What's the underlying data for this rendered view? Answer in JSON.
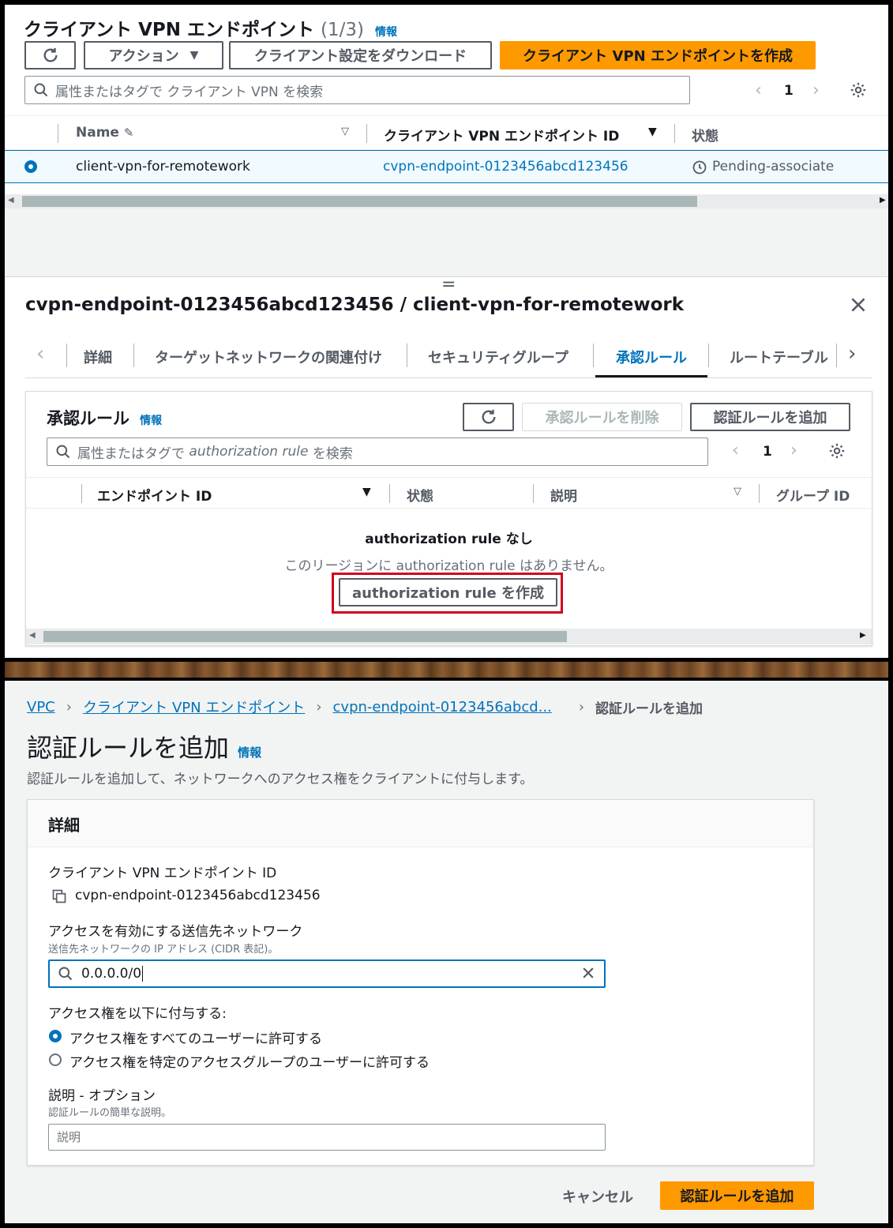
{
  "top": {
    "title": "クライアント VPN エンドポイント",
    "count": "(1/3)",
    "info": "情報",
    "actions_label": "アクション",
    "download_label": "クライアント設定をダウンロード",
    "create_label": "クライアント VPN エンドポイントを作成",
    "search_placeholder": "属性またはタグで クライアント VPN を検索",
    "page": "1",
    "columns": [
      "Name",
      "クライアント VPN エンドポイント ID",
      "状態"
    ],
    "row": {
      "name": "client-vpn-for-remotework",
      "endpoint_id": "cvpn-endpoint-0123456abcd123456",
      "status": "Pending-associate"
    }
  },
  "detail": {
    "drag_handle": "=",
    "title": "cvpn-endpoint-0123456abcd123456 / client-vpn-for-remotework",
    "tabs": [
      "詳細",
      "ターゲットネットワークの関連付け",
      "セキュリティグループ",
      "承認ルール",
      "ルートテーブル"
    ],
    "active_tab": "承認ルール",
    "section_title": "承認ルール",
    "info": "情報",
    "delete_label": "承認ルールを削除",
    "add_label": "認証ルールを追加",
    "search_prefix": "属性またはタグで",
    "search_term": "authorization rule",
    "search_suffix": "を検索",
    "page": "1",
    "columns": [
      "エンドポイント ID",
      "状態",
      "説明",
      "グループ ID"
    ],
    "empty_title": "authorization rule なし",
    "empty_desc": "このリージョンに authorization rule はありません。",
    "empty_button": "authorization rule を作成"
  },
  "form": {
    "breadcrumb": [
      "VPC",
      "クライアント VPN エンドポイント",
      "cvpn-endpoint-0123456abcd...",
      "認証ルールを追加"
    ],
    "title": "認証ルールを追加",
    "info": "情報",
    "description": "認証ルールを追加して、ネットワークへのアクセス権をクライアントに付与します。",
    "section": "詳細",
    "endpoint_label": "クライアント VPN エンドポイント ID",
    "endpoint_value": "cvpn-endpoint-0123456abcd123456",
    "network_label": "アクセスを有効にする送信先ネットワーク",
    "network_hint": "送信先ネットワークの IP アドレス (CIDR 表記)。",
    "network_value": "0.0.0.0/0",
    "grant_label": "アクセス権を以下に付与する:",
    "grant_options": [
      "アクセス権をすべてのユーザーに許可する",
      "アクセス権を特定のアクセスグループのユーザーに許可する"
    ],
    "grant_selected": 0,
    "desc_label": "説明 - オプション",
    "desc_hint": "認証ルールの簡単な説明。",
    "desc_placeholder": "説明",
    "cancel": "キャンセル",
    "submit": "認証ルールを追加"
  },
  "colors": {
    "accent": "#ff9900",
    "link": "#0073bb",
    "highlight": "#d0021b",
    "selected_row": "#f1faff"
  }
}
